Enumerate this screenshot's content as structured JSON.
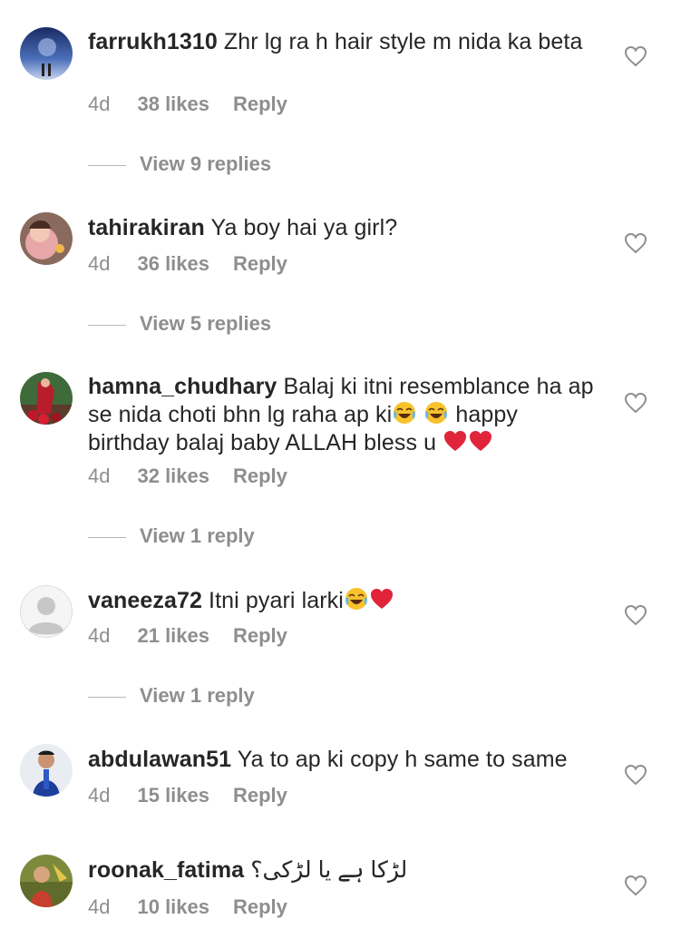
{
  "comments": [
    {
      "username": "farrukh1310",
      "text": "Zhr lg ra h hair style m nida ka beta",
      "time": "4d",
      "likes": "38 likes",
      "reply": "Reply",
      "view_replies": "View 9 replies"
    },
    {
      "username": "tahirakiran",
      "text": "Ya boy hai ya girl?",
      "time": "4d",
      "likes": "36 likes",
      "reply": "Reply",
      "view_replies": "View 5 replies"
    },
    {
      "username": "hamna_chudhary",
      "text_part1": "Balaj ki itni resemblance ha ap se nida choti bhn lg raha ap ki",
      "text_part2": "happy birthday balaj baby ALLAH bless u",
      "time": "4d",
      "likes": "32 likes",
      "reply": "Reply",
      "view_replies": "View 1 reply"
    },
    {
      "username": "vaneeza72",
      "text": "Itni pyari larki",
      "time": "4d",
      "likes": "21 likes",
      "reply": "Reply",
      "view_replies": "View 1 reply"
    },
    {
      "username": "abdulawan51",
      "text": "Ya to ap ki copy h same to same",
      "time": "4d",
      "likes": "15 likes",
      "reply": "Reply"
    },
    {
      "username": "roonak_fatima",
      "text": "لڑکا ہے یا لڑکی؟",
      "time": "4d",
      "likes": "10 likes",
      "reply": "Reply"
    }
  ],
  "icons": {
    "heart": "heart-outline-icon",
    "laugh_emoji": "face-with-tears-of-joy-emoji",
    "red_heart_emoji": "red-heart-emoji"
  },
  "colors": {
    "text": "#262626",
    "secondary": "#8e8e8e",
    "emoji_heart": "#e0243a",
    "emoji_face": "#f7c22c"
  }
}
